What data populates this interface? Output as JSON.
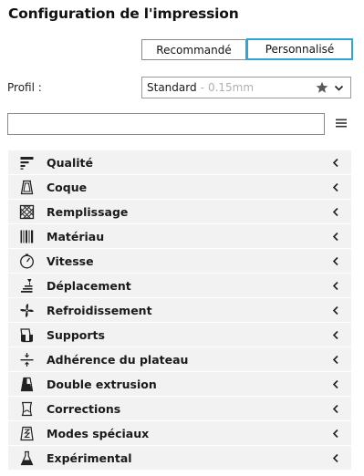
{
  "header": {
    "title": "Configuration de l'impression"
  },
  "mode": {
    "recommended_label": "Recommandé",
    "custom_label": "Personnalisé",
    "selected": "Personnalisé"
  },
  "profile": {
    "label": "Profil :",
    "name": "Standard",
    "separator": "-",
    "layer_height": "0.15mm"
  },
  "search": {
    "value": "",
    "placeholder": ""
  },
  "categories": [
    {
      "label": "Qualité",
      "icon": "quality-icon"
    },
    {
      "label": "Coque",
      "icon": "shell-icon"
    },
    {
      "label": "Remplissage",
      "icon": "infill-icon"
    },
    {
      "label": "Matériau",
      "icon": "material-icon"
    },
    {
      "label": "Vitesse",
      "icon": "speed-icon"
    },
    {
      "label": "Déplacement",
      "icon": "travel-icon"
    },
    {
      "label": "Refroidissement",
      "icon": "cooling-icon"
    },
    {
      "label": "Supports",
      "icon": "support-icon"
    },
    {
      "label": "Adhérence du plateau",
      "icon": "adhesion-icon"
    },
    {
      "label": "Double extrusion",
      "icon": "dual-extrusion-icon"
    },
    {
      "label": "Corrections",
      "icon": "fixes-icon"
    },
    {
      "label": "Modes spéciaux",
      "icon": "special-modes-icon"
    },
    {
      "label": "Expérimental",
      "icon": "experimental-icon"
    }
  ],
  "colors": {
    "accent": "#2fa4d9",
    "row_bg": "#f2f2f2",
    "muted_text": "#b0b0b0"
  }
}
